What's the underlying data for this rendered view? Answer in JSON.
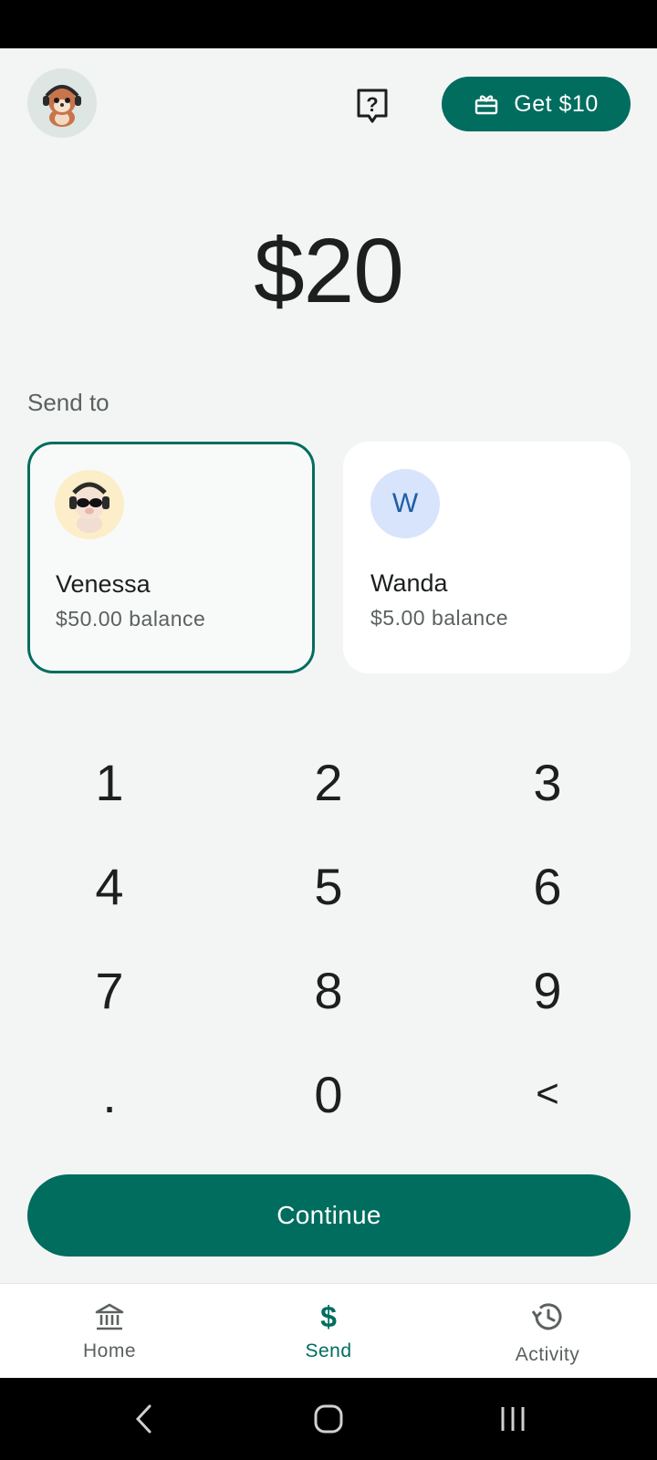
{
  "header": {
    "get_button_label": "Get $10",
    "help_icon": "help-icon",
    "gift_icon": "gift-icon"
  },
  "amount": "$20",
  "send_to_label": "Send to",
  "recipients": [
    {
      "name": "Venessa",
      "balance": "$50.00 balance",
      "selected": true,
      "avatar": "cartoon-animal-sunglasses"
    },
    {
      "name": "Wanda",
      "balance": "$5.00 balance",
      "selected": false,
      "initial": "W"
    }
  ],
  "keypad": {
    "keys": [
      "1",
      "2",
      "3",
      "4",
      "5",
      "6",
      "7",
      "8",
      "9",
      ".",
      "0",
      "<"
    ]
  },
  "continue_label": "Continue",
  "bottom_nav": {
    "items": [
      {
        "label": "Home",
        "icon": "bank-icon",
        "active": false
      },
      {
        "label": "Send",
        "icon": "dollar-icon",
        "active": true
      },
      {
        "label": "Activity",
        "icon": "history-icon",
        "active": false
      }
    ]
  },
  "colors": {
    "accent": "#006d5f",
    "background": "#f3f5f4",
    "initial_avatar_bg": "#d8e4fb"
  }
}
